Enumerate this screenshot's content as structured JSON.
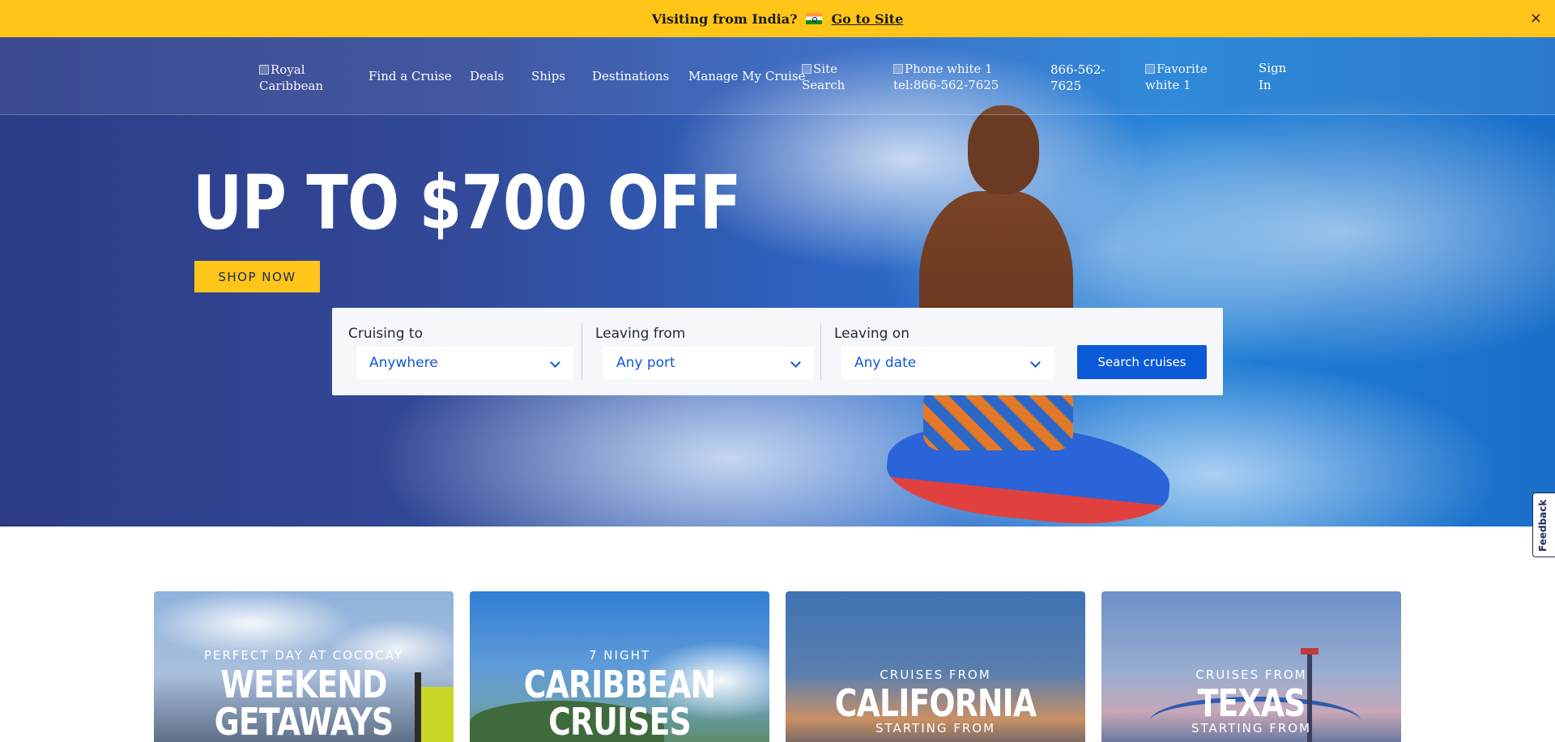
{
  "banner": {
    "question": "Visiting from India?",
    "link_label": "Go to Site",
    "close_glyph": "×",
    "flag_icon": "india-flag-icon",
    "background_color": "#ffc518"
  },
  "nav": {
    "logo_alt": "Royal Caribbean",
    "items": [
      {
        "label": "Find a Cruise"
      },
      {
        "label": "Deals"
      },
      {
        "label": "Ships"
      },
      {
        "label": "Destinations"
      },
      {
        "label": "Manage My Cruise"
      }
    ],
    "search_alt": "Site Search",
    "phone_alt": "Phone white 1 tel:866-562-7625",
    "phone_number": "866-562-7625",
    "favorite_alt": "Favorite white 1",
    "sign_in": "Sign In"
  },
  "hero": {
    "headline": "UP TO $700 OFF",
    "cta": "SHOP NOW",
    "cta_color": "#ffc518"
  },
  "search": {
    "fields": [
      {
        "label": "Cruising to",
        "value": "Anywhere"
      },
      {
        "label": "Leaving from",
        "value": "Any port"
      },
      {
        "label": "Leaving on",
        "value": "Any date"
      }
    ],
    "button": "Search cruises",
    "button_color": "#0a5ad8",
    "value_color": "#1257d9"
  },
  "feedback": {
    "label": "Feedback"
  },
  "cards": [
    {
      "eyebrow": "PERFECT DAY AT COCOCAY",
      "title_line1": "WEEKEND",
      "title_line2": "GETAWAYS"
    },
    {
      "eyebrow": "7 NIGHT",
      "title_line1": "CARIBBEAN",
      "title_line2": "CRUISES"
    },
    {
      "eyebrow": "CRUISES FROM",
      "title_line1": "CALIFORNIA",
      "subtitle": "STARTING FROM"
    },
    {
      "eyebrow": "CRUISES FROM",
      "title_line1": "TEXAS",
      "subtitle": "STARTING FROM"
    }
  ]
}
